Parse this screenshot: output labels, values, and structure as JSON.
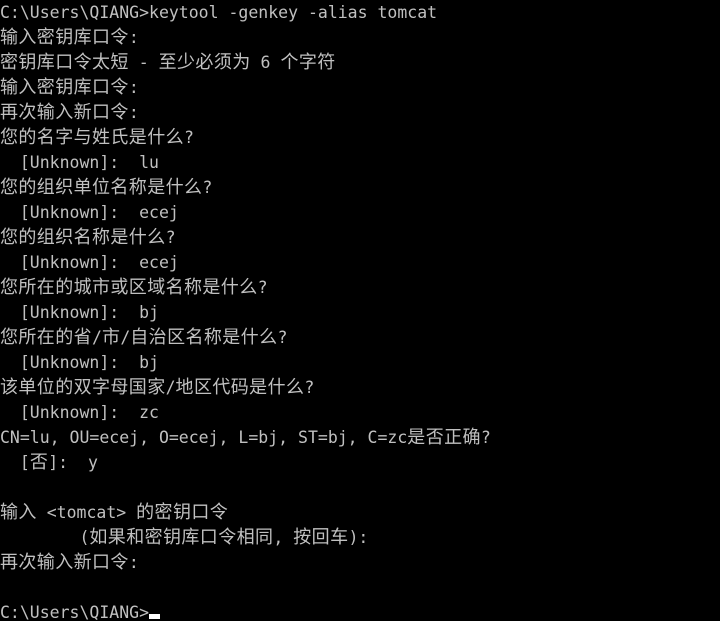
{
  "window": {
    "title": "C:\\Windows\\system32\\cmd.exe",
    "background_color": "#000000",
    "text_color": "#c0c0c0",
    "cursor_color": "#ffffff"
  },
  "terminal": {
    "prompt": "C:\\Users\\QIANG>",
    "command": "keytool -genkey -alias tomcat",
    "columns": 61,
    "rows": 25,
    "lines": [
      {
        "id": "line-01",
        "kind": "prompt-command",
        "text": "C:\\Users\\QIANG>keytool -genkey -alias tomcat"
      },
      {
        "id": "line-02",
        "kind": "prompt-text",
        "text": "输入密钥库口令:"
      },
      {
        "id": "line-03",
        "kind": "error",
        "text": "密钥库口令太短 - 至少必须为 6 个字符"
      },
      {
        "id": "line-04",
        "kind": "prompt-text",
        "text": "输入密钥库口令:"
      },
      {
        "id": "line-05",
        "kind": "prompt-text",
        "text": "再次输入新口令:"
      },
      {
        "id": "line-06",
        "kind": "question",
        "text": "您的名字与姓氏是什么?"
      },
      {
        "id": "line-07",
        "kind": "answer",
        "text": "  [Unknown]:  lu"
      },
      {
        "id": "line-08",
        "kind": "question",
        "text": "您的组织单位名称是什么?"
      },
      {
        "id": "line-09",
        "kind": "answer",
        "text": "  [Unknown]:  ecej"
      },
      {
        "id": "line-10",
        "kind": "question",
        "text": "您的组织名称是什么?"
      },
      {
        "id": "line-11",
        "kind": "answer",
        "text": "  [Unknown]:  ecej"
      },
      {
        "id": "line-12",
        "kind": "question",
        "text": "您所在的城市或区域名称是什么?"
      },
      {
        "id": "line-13",
        "kind": "answer",
        "text": "  [Unknown]:  bj"
      },
      {
        "id": "line-14",
        "kind": "question",
        "text": "您所在的省/市/自治区名称是什么?"
      },
      {
        "id": "line-15",
        "kind": "answer",
        "text": "  [Unknown]:  bj"
      },
      {
        "id": "line-16",
        "kind": "question",
        "text": "该单位的双字母国家/地区代码是什么?"
      },
      {
        "id": "line-17",
        "kind": "answer",
        "text": "  [Unknown]:  zc"
      },
      {
        "id": "line-18",
        "kind": "confirm",
        "text": "CN=lu, OU=ecej, O=ecej, L=bj, ST=bj, C=zc是否正确?"
      },
      {
        "id": "line-19",
        "kind": "answer",
        "text": "  [否]:  y"
      },
      {
        "id": "line-20",
        "kind": "blank",
        "text": ""
      },
      {
        "id": "line-21",
        "kind": "prompt-text",
        "text": "输入 <tomcat> 的密钥口令"
      },
      {
        "id": "line-22",
        "kind": "prompt-text",
        "text": "        (如果和密钥库口令相同, 按回车):"
      },
      {
        "id": "line-23",
        "kind": "prompt-text",
        "text": "再次输入新口令:"
      },
      {
        "id": "line-24",
        "kind": "blank",
        "text": ""
      },
      {
        "id": "line-25",
        "kind": "final-prompt",
        "text": "C:\\Users\\QIANG>"
      }
    ]
  },
  "distinguished_name": {
    "CN": "lu",
    "OU": "ecej",
    "O": "ecej",
    "L": "bj",
    "ST": "bj",
    "C": "zc",
    "confirmed": "y",
    "default_choice": "否"
  },
  "keytool": {
    "alias": "tomcat",
    "unknown_placeholder": "[Unknown]",
    "min_password_length": "6"
  }
}
